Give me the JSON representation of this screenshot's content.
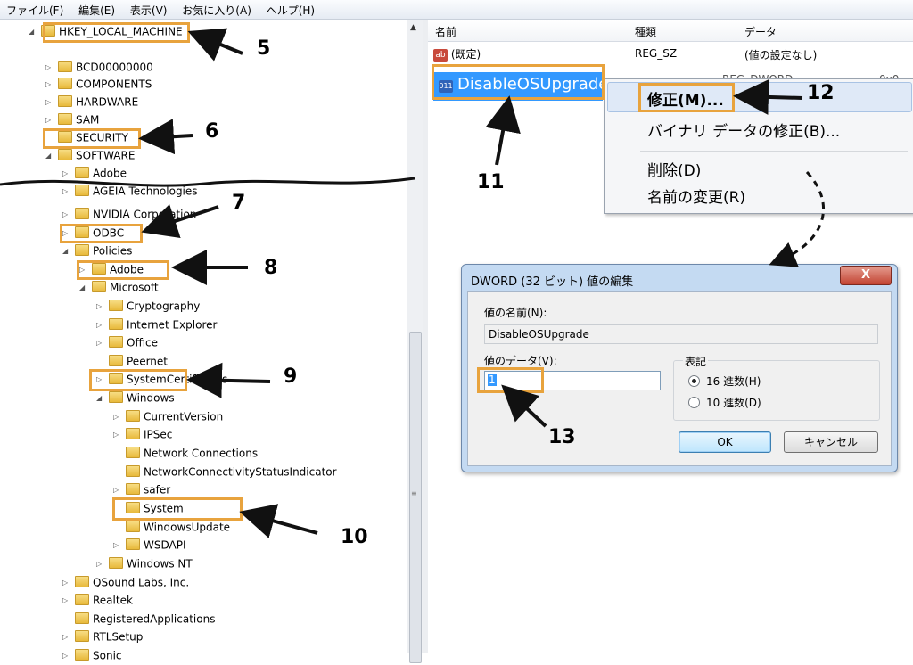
{
  "menubar": [
    "ファイル(F)",
    "編集(E)",
    "表示(V)",
    "お気に入り(A)",
    "ヘルプ(H)"
  ],
  "tree": [
    {
      "label": "HKEY_LOCAL_MACHINE",
      "indent": 0,
      "expander": "open",
      "folder": true
    },
    {
      "label": "BCD00000000",
      "indent": 1,
      "expander": "closed",
      "folder": true
    },
    {
      "label": "COMPONENTS",
      "indent": 1,
      "expander": "closed",
      "folder": true
    },
    {
      "label": "HARDWARE",
      "indent": 1,
      "expander": "closed",
      "folder": true
    },
    {
      "label": "SAM",
      "indent": 1,
      "expander": "closed",
      "folder": true
    },
    {
      "label": "SECURITY",
      "indent": 1,
      "expander": "none",
      "folder": true
    },
    {
      "label": "SOFTWARE",
      "indent": 1,
      "expander": "open",
      "folder": true
    },
    {
      "label": "Adobe",
      "indent": 2,
      "expander": "closed",
      "folder": true
    },
    {
      "label": "AGEIA Technologies",
      "indent": 2,
      "expander": "closed",
      "folder": true
    },
    {
      "label": "NVIDIA Corporation",
      "indent": 2,
      "expander": "closed",
      "folder": true
    },
    {
      "label": "ODBC",
      "indent": 2,
      "expander": "closed",
      "folder": true
    },
    {
      "label": "Policies",
      "indent": 2,
      "expander": "open",
      "folder": true
    },
    {
      "label": "Adobe",
      "indent": 3,
      "expander": "closed",
      "folder": true
    },
    {
      "label": "Microsoft",
      "indent": 3,
      "expander": "open",
      "folder": true
    },
    {
      "label": "Cryptography",
      "indent": 4,
      "expander": "closed",
      "folder": true
    },
    {
      "label": "Internet Explorer",
      "indent": 4,
      "expander": "closed",
      "folder": true
    },
    {
      "label": "Office",
      "indent": 4,
      "expander": "closed",
      "folder": true
    },
    {
      "label": "Peernet",
      "indent": 4,
      "expander": "none",
      "folder": true
    },
    {
      "label": "SystemCertificates",
      "indent": 4,
      "expander": "closed",
      "folder": true
    },
    {
      "label": "Windows",
      "indent": 4,
      "expander": "open",
      "folder": true
    },
    {
      "label": "CurrentVersion",
      "indent": 5,
      "expander": "closed",
      "folder": true
    },
    {
      "label": "IPSec",
      "indent": 5,
      "expander": "closed",
      "folder": true
    },
    {
      "label": "Network Connections",
      "indent": 5,
      "expander": "none",
      "folder": true
    },
    {
      "label": "NetworkConnectivityStatusIndicator",
      "indent": 5,
      "expander": "none",
      "folder": true
    },
    {
      "label": "safer",
      "indent": 5,
      "expander": "closed",
      "folder": true
    },
    {
      "label": "System",
      "indent": 5,
      "expander": "none",
      "folder": true
    },
    {
      "label": "WindowsUpdate",
      "indent": 5,
      "expander": "none",
      "folder": true
    },
    {
      "label": "WSDAPI",
      "indent": 5,
      "expander": "closed",
      "folder": true
    },
    {
      "label": "Windows NT",
      "indent": 4,
      "expander": "closed",
      "folder": true
    },
    {
      "label": "QSound Labs, Inc.",
      "indent": 2,
      "expander": "closed",
      "folder": true
    },
    {
      "label": "Realtek",
      "indent": 2,
      "expander": "closed",
      "folder": true
    },
    {
      "label": "RegisteredApplications",
      "indent": 2,
      "expander": "none",
      "folder": true
    },
    {
      "label": "RTLSetup",
      "indent": 2,
      "expander": "closed",
      "folder": true
    },
    {
      "label": "Sonic",
      "indent": 2,
      "expander": "closed",
      "folder": true
    }
  ],
  "values_pane": {
    "columns": {
      "name": "名前",
      "type": "種類",
      "data": "データ"
    },
    "rows": [
      {
        "name": "(既定)",
        "type": "REG_SZ",
        "data": "(値の設定なし)",
        "icon": "ab"
      },
      {
        "name": "DisableOSUpgrade",
        "type": "REG_DWORD",
        "data": "0x0",
        "icon": "011"
      }
    ]
  },
  "context_menu": {
    "items": [
      "修正(M)...",
      "バイナリ データの修正(B)...",
      "削除(D)",
      "名前の変更(R)"
    ]
  },
  "dialog": {
    "title": "DWORD (32 ビット) 値の編集",
    "close": "X",
    "value_name_label": "値の名前(N):",
    "value_name": "DisableOSUpgrade",
    "value_data_label": "値のデータ(V):",
    "value_data": "1",
    "base_label": "表記",
    "hex_label": "16 進数(H)",
    "dec_label": "10 進数(D)",
    "ok": "OK",
    "cancel": "キャンセル"
  },
  "annotations": [
    "5",
    "6",
    "7",
    "8",
    "9",
    "10",
    "11",
    "12",
    "13"
  ]
}
